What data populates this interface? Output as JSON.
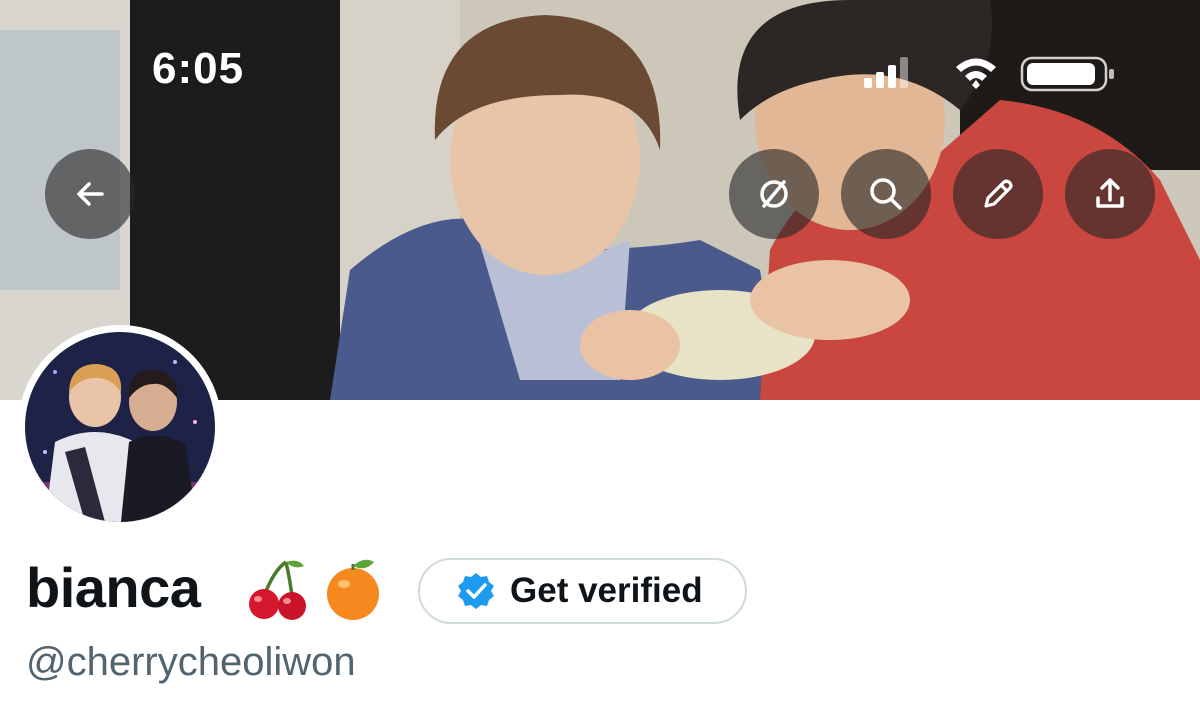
{
  "status_bar": {
    "time": "6:05"
  },
  "toolbar": {
    "back": "back-arrow-icon",
    "circle": "circle-slash-icon",
    "search": "search-icon",
    "edit": "pencil-icon",
    "share": "share-icon"
  },
  "profile": {
    "display_name": "bianca",
    "emojis": [
      "cherries-emoji",
      "tangerine-emoji"
    ],
    "handle": "@cherrycheoliwon",
    "get_verified_label": "Get verified"
  },
  "colors": {
    "verified_blue": "#1d9bf0",
    "text_primary": "#0f1419",
    "text_secondary": "#536471"
  }
}
